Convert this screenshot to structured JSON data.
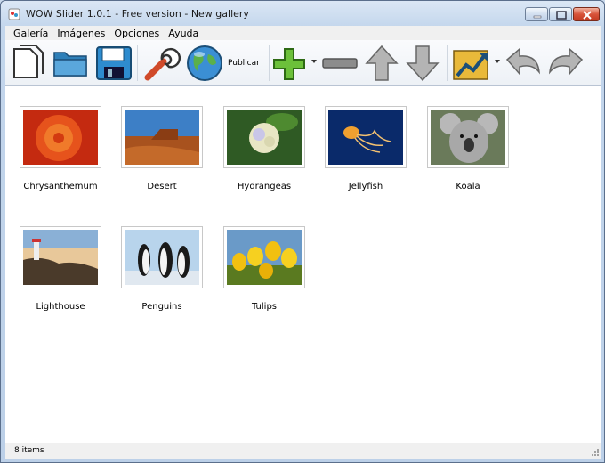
{
  "window": {
    "title": "WOW Slider 1.0.1 - Free version - New gallery"
  },
  "menu": {
    "items": [
      "Galería",
      "Imágenes",
      "Opciones",
      "Ayuda"
    ]
  },
  "toolbar": {
    "publish_label": "Publicar"
  },
  "gallery": {
    "items": [
      {
        "name": "Chrysanthemum"
      },
      {
        "name": "Desert"
      },
      {
        "name": "Hydrangeas"
      },
      {
        "name": "Jellyfish"
      },
      {
        "name": "Koala"
      },
      {
        "name": "Lighthouse"
      },
      {
        "name": "Penguins"
      },
      {
        "name": "Tulips"
      }
    ]
  },
  "status": {
    "text": "8 items"
  },
  "icons": [
    "new-document-icon",
    "open-folder-icon",
    "save-icon",
    "wrench-icon",
    "globe-icon",
    "add-icon",
    "remove-icon",
    "arrow-up-icon",
    "arrow-down-icon",
    "chart-icon",
    "undo-icon",
    "redo-icon"
  ]
}
